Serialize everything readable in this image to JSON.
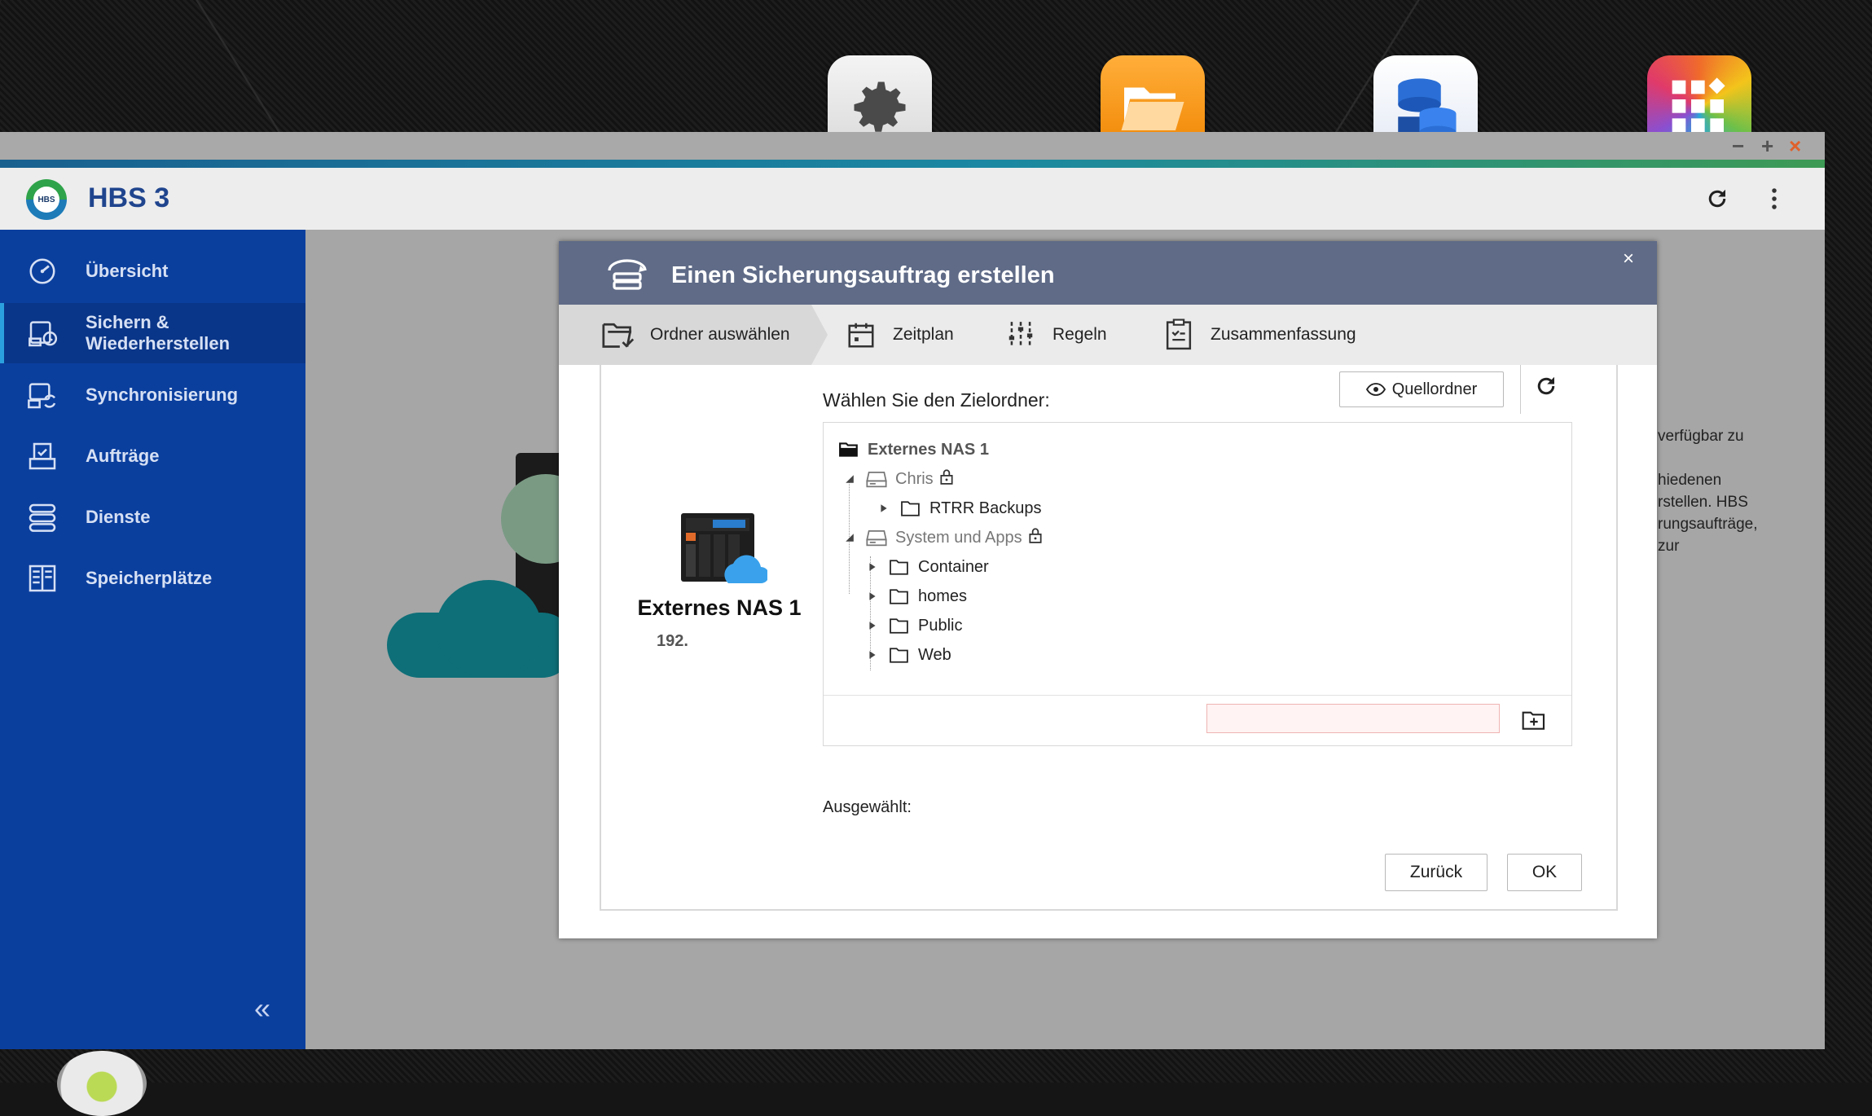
{
  "desktop": {
    "icons": [
      {
        "name": "settings-app-icon"
      },
      {
        "name": "file-station-app-icon"
      },
      {
        "name": "storage-app-icon"
      },
      {
        "name": "app-center-icon"
      }
    ]
  },
  "window": {
    "controls": {
      "minimize": "−",
      "maximize": "+",
      "close": "×"
    }
  },
  "app": {
    "title": "HBS 3",
    "logo_text": "HBS"
  },
  "sidebar": {
    "items": [
      {
        "label": "Übersicht",
        "icon": "gauge-icon"
      },
      {
        "label": "Sichern &\nWiederherstellen",
        "icon": "backup-restore-icon",
        "active": true
      },
      {
        "label": "Synchronisierung",
        "icon": "sync-icon"
      },
      {
        "label": "Aufträge",
        "icon": "jobs-icon"
      },
      {
        "label": "Dienste",
        "icon": "services-icon"
      },
      {
        "label": "Speicherplätze",
        "icon": "storage-spaces-icon"
      }
    ],
    "collapse_label": "«"
  },
  "background_text": [
    "verfügbar zu",
    "hiedenen",
    "rstellen. HBS",
    "rungsaufträge,",
    "zur"
  ],
  "dialog": {
    "title": "Einen Sicherungsauftrag erstellen",
    "close": "×",
    "steps": [
      {
        "label": "Ordner auswählen",
        "active": true
      },
      {
        "label": "Zeitplan"
      },
      {
        "label": "Regeln"
      },
      {
        "label": "Zusammenfassung"
      }
    ],
    "device": {
      "name": "Externes NAS 1",
      "ip_prefix": "192."
    },
    "choose_label": "Wählen Sie den Zielordner:",
    "source_button": "Quellordner",
    "tree": {
      "root": "Externes NAS 1",
      "nodes": [
        {
          "label": "Chris",
          "type": "share",
          "locked": true,
          "expanded": true,
          "children": [
            {
              "label": "RTRR Backups",
              "type": "folder"
            }
          ]
        },
        {
          "label": "System und Apps",
          "type": "share",
          "locked": true,
          "expanded": true,
          "children": [
            {
              "label": "Container",
              "type": "folder"
            },
            {
              "label": "homes",
              "type": "folder"
            },
            {
              "label": "Public",
              "type": "folder"
            },
            {
              "label": "Web",
              "type": "folder"
            }
          ]
        }
      ]
    },
    "new_folder_value": "",
    "selected_label": "Ausgewählt:",
    "buttons": {
      "back": "Zurück",
      "ok": "OK"
    }
  }
}
